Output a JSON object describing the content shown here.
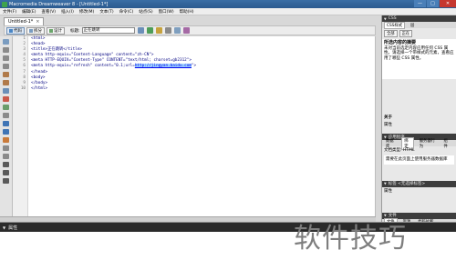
{
  "window": {
    "title": "Macromedia Dreamweaver 8 - [Untitled-1*]",
    "minimize": "—",
    "maximize": "□",
    "close": "✕"
  },
  "menu": [
    "文件(F)",
    "编辑(E)",
    "查看(V)",
    "插入(I)",
    "修改(M)",
    "文本(T)",
    "命令(C)",
    "站点(S)",
    "窗口(W)",
    "帮助(H)"
  ],
  "document": {
    "tab_label": "Untitled-1*",
    "tab_close": "×",
    "views": {
      "code": "代码",
      "split": "拆分",
      "design": "设计"
    },
    "title_label": "标题:",
    "title_value": "正在跳转"
  },
  "code_lines": [
    {
      "n": "1",
      "text": "<html>"
    },
    {
      "n": "2",
      "text": "<head>"
    },
    {
      "n": "3",
      "text": "<title>正在跳转</title>"
    },
    {
      "n": "4",
      "text": "<meta http-equiv=\"Content-Language\" content=\"zh-CN\">"
    },
    {
      "n": "5",
      "text": "<meta HTTP-EQUIV=\"Content-Type\" CONTENT=\"text/html; charset=gb2312\">"
    },
    {
      "n": "6",
      "pre": "<meta http-equiv=\"refresh\" content=\"0.1;url=",
      "url": "http://jingyan.baidu.com",
      "post": "\">"
    },
    {
      "n": "7",
      "text": "</head>"
    },
    {
      "n": "8",
      "text": "<body>"
    },
    {
      "n": "9",
      "text": "</body>"
    },
    {
      "n": "10",
      "text": "</html>"
    }
  ],
  "right_panel": {
    "css_header": "CSS",
    "css_tabs": [
      "CSS样式",
      "层"
    ],
    "css_buttons": [
      "全部",
      "正在"
    ],
    "css_title": "所选内容的摘要",
    "css_desc": "未对当前选定内容应用任何 CSS 属性。请选择一个带样式的元素，查看应用了哪些 CSS 属性。",
    "about_header": "关于",
    "props_label": "属性",
    "app_header": "应用程序",
    "app_tabs": [
      "数据库",
      "绑定",
      "服务器行为",
      "组件"
    ],
    "doc_type_label": "文档类型: HTML",
    "app_text": "需要在此页面上使用服务器数据库",
    "tag_header": "标签 <无选择标签>",
    "tag_attr_label": "属性",
    "files_header": "文件",
    "files_tabs": [
      "文件",
      "资源",
      "代码片断"
    ]
  },
  "properties_panel": {
    "header": "属性"
  },
  "watermark": "软件技巧",
  "colors": {
    "titlebar": "#2b5a8f",
    "code_text": "#000080",
    "url_highlight": "#9fd3ff",
    "properties_header": "#2a2a2a"
  }
}
